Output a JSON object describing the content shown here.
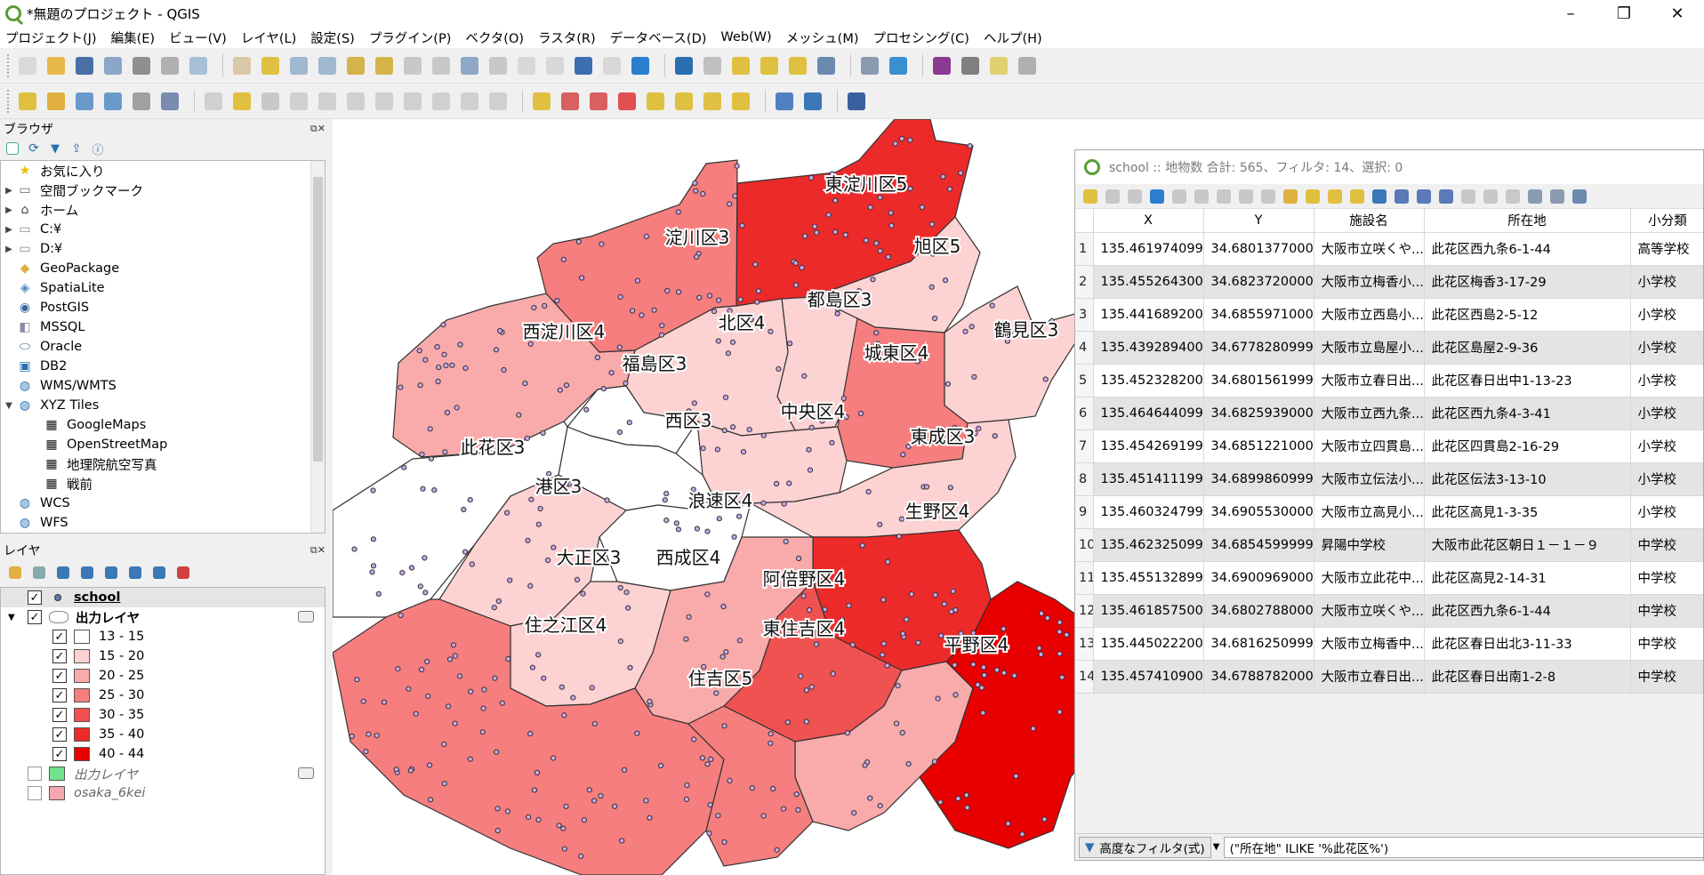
{
  "window": {
    "title": "*無題のプロジェクト - QGIS",
    "min": "–",
    "max": "❐",
    "close": "✕"
  },
  "menu": [
    "プロジェクト(J)",
    "編集(E)",
    "ビュー(V)",
    "レイヤ(L)",
    "設定(S)",
    "プラグイン(P)",
    "ベクタ(O)",
    "ラスタ(R)",
    "データベース(D)",
    "Web(W)",
    "メッシュ(M)",
    "プロセシング(C)",
    "ヘルプ(H)"
  ],
  "browser": {
    "title": "ブラウザ",
    "items": [
      {
        "label": "お気に入り",
        "icon": "star-icon",
        "arrow": ""
      },
      {
        "label": "空間ブックマーク",
        "icon": "bookmark-icon",
        "arrow": "▶"
      },
      {
        "label": "ホーム",
        "icon": "home-icon",
        "arrow": "▶"
      },
      {
        "label": "C:¥",
        "icon": "folder-icon",
        "arrow": "▶"
      },
      {
        "label": "D:¥",
        "icon": "folder-icon",
        "arrow": "▶"
      },
      {
        "label": "GeoPackage",
        "icon": "geopackage-icon",
        "arrow": ""
      },
      {
        "label": "SpatiaLite",
        "icon": "spatialite-icon",
        "arrow": ""
      },
      {
        "label": "PostGIS",
        "icon": "postgis-icon",
        "arrow": ""
      },
      {
        "label": "MSSQL",
        "icon": "mssql-icon",
        "arrow": ""
      },
      {
        "label": "Oracle",
        "icon": "oracle-icon",
        "arrow": ""
      },
      {
        "label": "DB2",
        "icon": "db2-icon",
        "arrow": ""
      },
      {
        "label": "WMS/WMTS",
        "icon": "globe-icon",
        "arrow": ""
      },
      {
        "label": "XYZ Tiles",
        "icon": "globe-icon",
        "arrow": "▼"
      },
      {
        "label": "GoogleMaps",
        "icon": "tiles-icon",
        "arrow": "",
        "indent": 1
      },
      {
        "label": "OpenStreetMap",
        "icon": "tiles-icon",
        "arrow": "",
        "indent": 1
      },
      {
        "label": "地理院航空写真",
        "icon": "tiles-icon",
        "arrow": "",
        "indent": 1
      },
      {
        "label": "戦前",
        "icon": "tiles-icon",
        "arrow": "",
        "indent": 1
      },
      {
        "label": "WCS",
        "icon": "globe-icon",
        "arrow": ""
      },
      {
        "label": "WFS",
        "icon": "globe-icon",
        "arrow": ""
      }
    ]
  },
  "layers": {
    "title": "レイヤ",
    "rows": [
      {
        "label": "school",
        "checked": true,
        "bold": true,
        "underline": true,
        "kind": "point",
        "indent": 0
      },
      {
        "label": "出力レイヤ",
        "checked": true,
        "bold": true,
        "kind": "poly",
        "indent": 0,
        "expand": "▼"
      },
      {
        "label": "13 - 15",
        "checked": true,
        "color": "#ffffff",
        "indent": 1
      },
      {
        "label": "15 - 20",
        "checked": true,
        "color": "#fcd2d2",
        "indent": 1
      },
      {
        "label": "20 - 25",
        "checked": true,
        "color": "#f9aaaa",
        "indent": 1
      },
      {
        "label": "25 - 30",
        "checked": true,
        "color": "#f67e7e",
        "indent": 1
      },
      {
        "label": "30 - 35",
        "checked": true,
        "color": "#f05252",
        "indent": 1
      },
      {
        "label": "35 - 40",
        "checked": true,
        "color": "#ec2a2a",
        "indent": 1
      },
      {
        "label": "40 - 44",
        "checked": true,
        "color": "#e80000",
        "indent": 1
      },
      {
        "label": "出力レイヤ",
        "checked": false,
        "italic": true,
        "color": "#6ee38c",
        "indent": 0
      },
      {
        "label": "osaka_6kei",
        "checked": false,
        "italic": true,
        "color": "#f4a8b0",
        "indent": 0
      }
    ]
  },
  "map": {
    "labels": [
      "東淀川区5",
      "淀川区3",
      "旭区5",
      "都島区3",
      "西淀川区4",
      "北区4",
      "鶴見区3",
      "城東区4",
      "福島区3",
      "中央区4",
      "西区3",
      "此花区3",
      "東成区3",
      "港区3",
      "浪速区4",
      "生野区4",
      "大正区3",
      "西成区4",
      "阿倍野区4",
      "住之江区4",
      "東住吉区4",
      "平野区4",
      "住吉区5"
    ]
  },
  "attr": {
    "title": "school :: 地物数 合計: 565、フィルタ: 14、選択: 0",
    "columns": [
      "X",
      "Y",
      "施設名",
      "所在地",
      "小分類"
    ],
    "rows": [
      [
        "135.461974099...",
        "34.6801377000...",
        "大阪市立咲くや...",
        "此花区西九条6-1-44",
        "高等学校"
      ],
      [
        "135.455264300...",
        "34.6823720000...",
        "大阪市立梅香小...",
        "此花区梅香3-17-29",
        "小学校"
      ],
      [
        "135.441689200...",
        "34.6855971000...",
        "大阪市立西島小...",
        "此花区西島2-5-12",
        "小学校"
      ],
      [
        "135.439289400...",
        "34.6778280999...",
        "大阪市立島屋小...",
        "此花区島屋2-9-36",
        "小学校"
      ],
      [
        "135.452328200...",
        "34.6801561999...",
        "大阪市立春日出...",
        "此花区春日出中1-13-23",
        "小学校"
      ],
      [
        "135.464644099...",
        "34.6825939000...",
        "大阪市立西九条...",
        "此花区西九条4-3-41",
        "小学校"
      ],
      [
        "135.454269199...",
        "34.6851221000...",
        "大阪市立四貫島...",
        "此花区四貫島2-16-29",
        "小学校"
      ],
      [
        "135.451411199...",
        "34.6899860999...",
        "大阪市立伝法小...",
        "此花区伝法3-13-10",
        "小学校"
      ],
      [
        "135.460324799...",
        "34.6905530000...",
        "大阪市立高見小...",
        "此花区高見1-3-35",
        "小学校"
      ],
      [
        "135.462325099...",
        "34.6854599999...",
        "昇陽中学校",
        "大阪市此花区朝日１－１－９",
        "中学校"
      ],
      [
        "135.455132899...",
        "34.6900969000...",
        "大阪市立此花中...",
        "此花区高見2-14-31",
        "中学校"
      ],
      [
        "135.461857500...",
        "34.6802788000...",
        "大阪市立咲くや...",
        "此花区西九条6-1-44",
        "中学校"
      ],
      [
        "135.445022200...",
        "34.6816250999...",
        "大阪市立梅香中...",
        "此花区春日出北3-11-33",
        "中学校"
      ],
      [
        "135.457410900...",
        "34.6788782000...",
        "大阪市立春日出...",
        "此花区春日出南1-2-8",
        "中学校"
      ]
    ],
    "filter_button": "高度なフィルタ(式)",
    "filter_expr": "(\"所在地\" ILIKE '%此花区%')"
  },
  "colors": {
    "c13": "#ffffff",
    "c15": "#fcd2d2",
    "c20": "#f9aaaa",
    "c25": "#f67e7e",
    "c30": "#f05252",
    "c35": "#ec2a2a",
    "c40": "#e80000"
  }
}
